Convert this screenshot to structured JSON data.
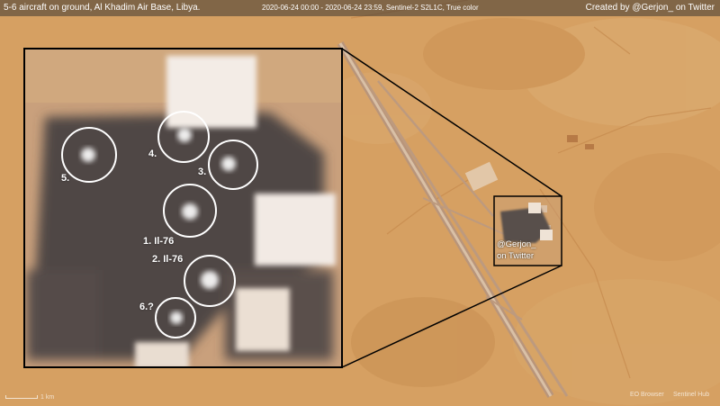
{
  "header": {
    "title": "5-6 aircraft on ground, Al Khadim Air Base, Libya.",
    "acquisition": "2020-06-24 00:00 - 2020-06-24 23:59, Sentinel-2 S2L1C, True color",
    "attribution": "Created by @Gerjon_ on Twitter"
  },
  "inset": {
    "markers": [
      {
        "label": "1. Il-76"
      },
      {
        "label": "2. Il-76"
      },
      {
        "label": "3."
      },
      {
        "label": "4."
      },
      {
        "label": "5."
      },
      {
        "label": "6.?"
      }
    ]
  },
  "map_credit": {
    "line1": "@Gerjon_",
    "line2": "on Twitter"
  },
  "footer": {
    "scale_text": "1 km",
    "logos": [
      "EO Browser",
      "Sentinel Hub"
    ]
  },
  "colors": {
    "sand": "#d49a5c",
    "inset_border": "#000000",
    "marker_circle": "#ffffff",
    "apron_dark": "#4a4340"
  }
}
